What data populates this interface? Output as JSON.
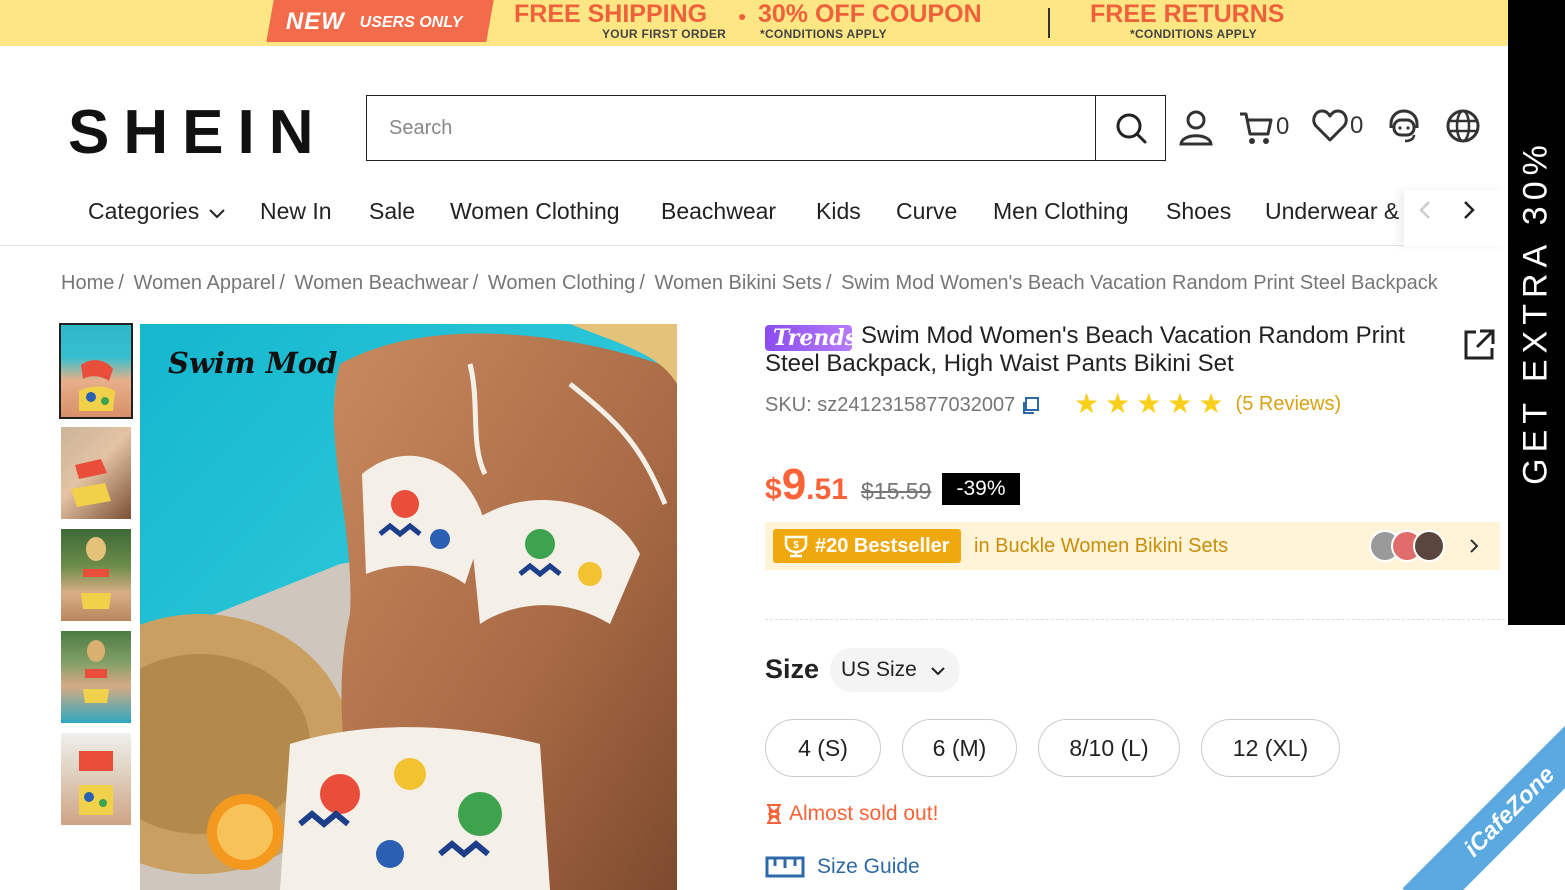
{
  "promo": {
    "new_label": "NEW",
    "users_only": "USERS ONLY",
    "free_shipping": "FREE SHIPPING",
    "coupon": "30% OFF COUPON",
    "first_order": "YOUR FIRST ORDER",
    "conditions1": "*CONDITIONS APPLY",
    "free_returns": "FREE RETURNS",
    "conditions2": "*CONDITIONS APPLY"
  },
  "side_banner": "GET EXTRA 30%",
  "header": {
    "logo": "SHEIN",
    "search_placeholder": "Search",
    "cart_count": "0",
    "wishlist_count": "0"
  },
  "nav": {
    "items": [
      "Categories",
      "New In",
      "Sale",
      "Women Clothing",
      "Beachwear",
      "Kids",
      "Curve",
      "Men Clothing",
      "Shoes",
      "Underwear &"
    ]
  },
  "breadcrumb": [
    "Home",
    "Women Apparel",
    "Women Beachwear",
    "Women Clothing",
    "Women Bikini Sets",
    "Swim Mod Women's Beach Vacation Random Print Steel Backpack"
  ],
  "image": {
    "brand_overlay": "Swim Mod"
  },
  "product": {
    "badge": "Trends",
    "title": "Swim Mod Women's Beach Vacation Random Print Steel Backpack, High Waist Pants Bikini Set",
    "sku": "SKU: sz2412315877032007",
    "rating": 5,
    "reviews": "(5 Reviews)",
    "price_symbol": "$",
    "price_int": "9",
    "price_dec": ".51",
    "old_price": "$15.59",
    "discount": "-39%",
    "bestseller_tag": "#20 Bestseller",
    "bestseller_text": "in Buckle Women Bikini Sets",
    "size_label": "Size",
    "size_system": "US Size",
    "sizes": [
      "4 (S)",
      "6 (M)",
      "8/10 (L)",
      "12 (XL)"
    ],
    "stock_notice": "Almost sold out!",
    "size_guide": "Size Guide"
  },
  "watermark": {
    "ribbon": "iCafeZone"
  },
  "colors": {
    "accent": "#fa6338",
    "promo_bg": "#fde784",
    "bestseller_bg": "#fff4d8",
    "bestseller_tag": "#f0a80f",
    "star": "#facf19",
    "link": "#2d68a8"
  }
}
